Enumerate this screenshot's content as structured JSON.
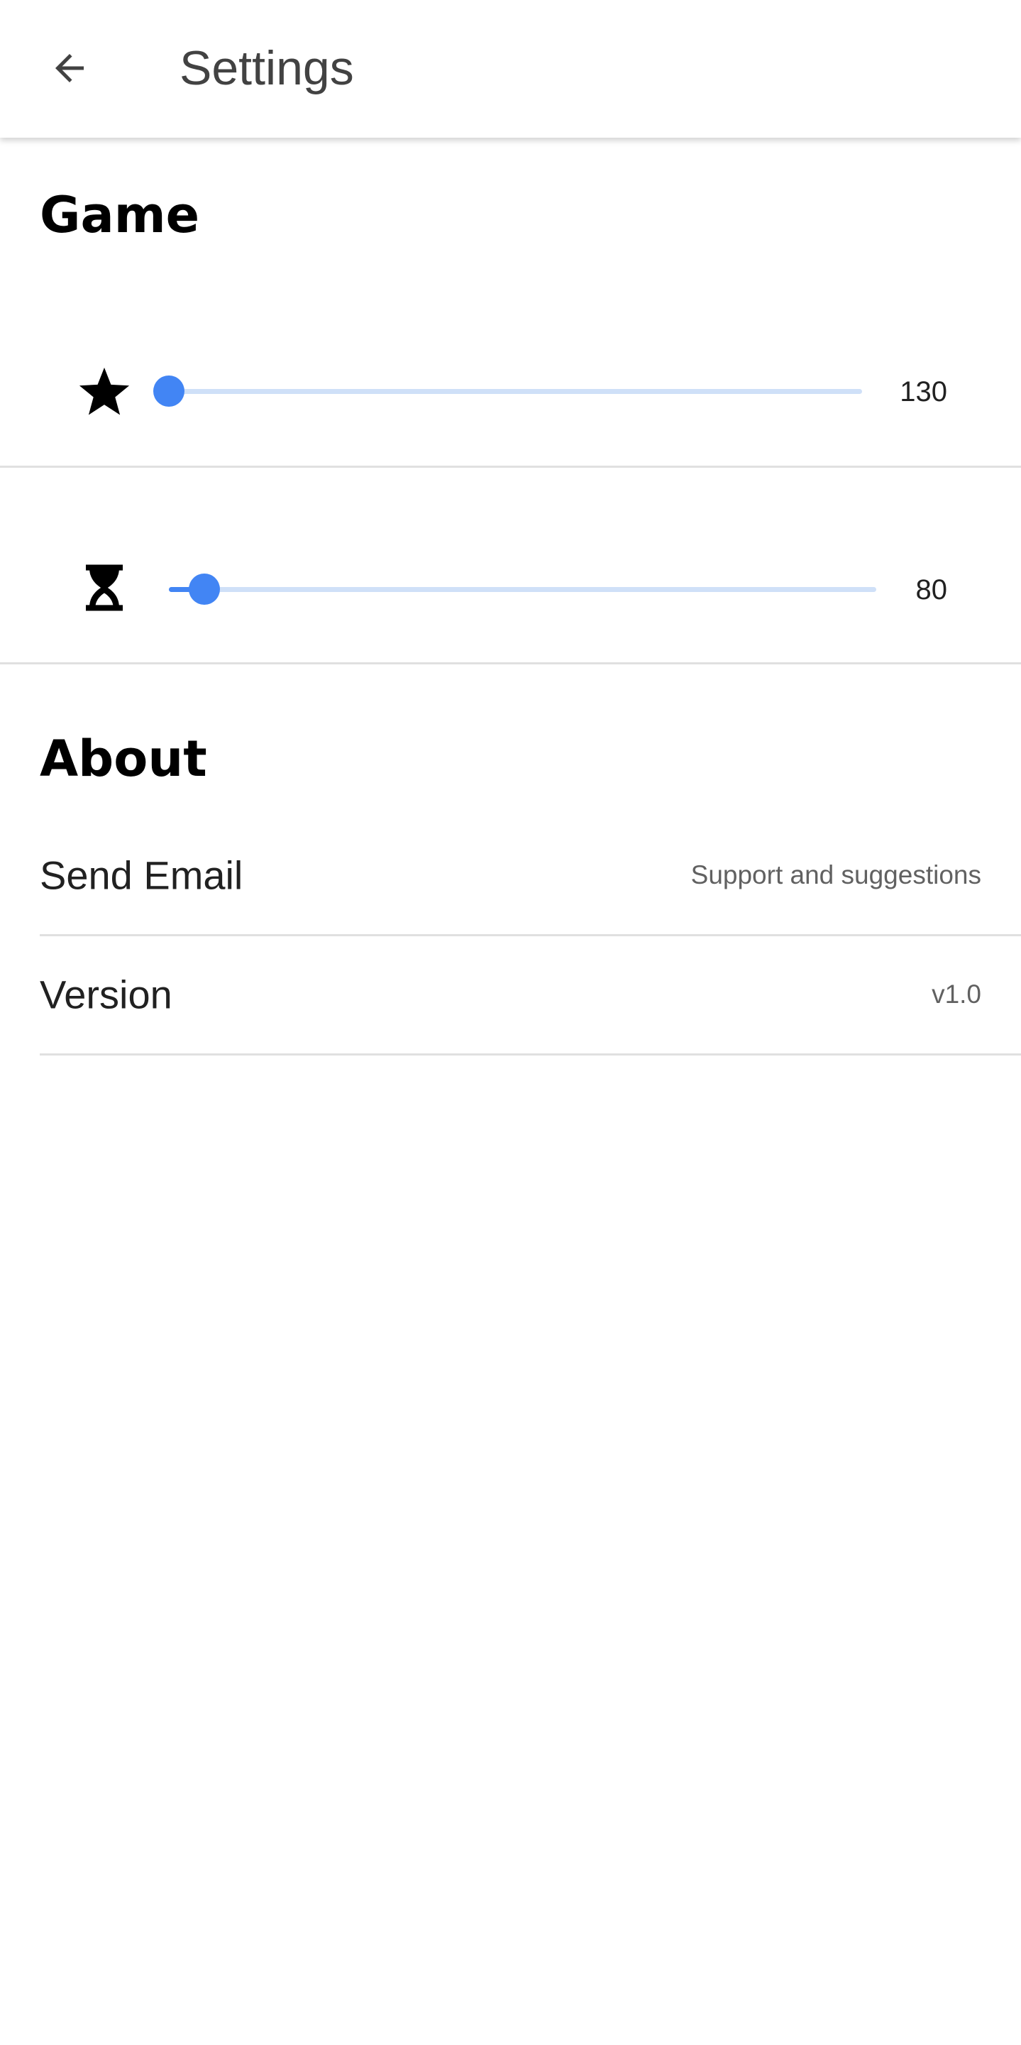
{
  "toolbar": {
    "title": "Settings",
    "back_icon": "arrow-back-icon"
  },
  "game": {
    "heading": "Game",
    "sliders": [
      {
        "icon": "star-icon",
        "value": "130",
        "level": 0.0
      },
      {
        "icon": "hourglass-icon",
        "value": "80",
        "level": 0.05
      }
    ]
  },
  "about": {
    "heading": "About",
    "items": [
      {
        "title": "Send Email",
        "summary": "Support and suggestions"
      },
      {
        "title": "Version",
        "summary": "v1.0"
      }
    ]
  },
  "colors": {
    "accent": "#4285f4",
    "track": "#cfe0f8",
    "divider": "#e0e0e0"
  }
}
